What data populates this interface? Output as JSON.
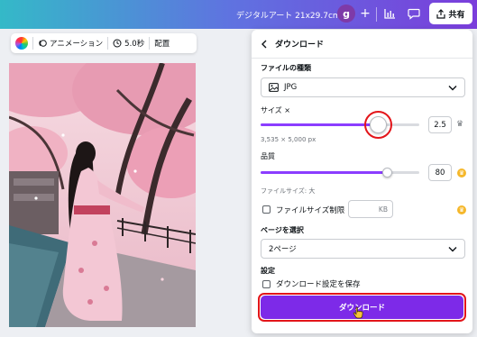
{
  "header": {
    "doc_title": "デジタルアート 21x29.7cm",
    "avatar_letter": "g",
    "plus": "+",
    "share_label": "共有"
  },
  "context_toolbar": {
    "animation_label": "アニメーション",
    "duration_label": "5.0秒",
    "position_label": "配置"
  },
  "download_panel": {
    "title": "ダウンロード",
    "file_type_label": "ファイルの種類",
    "file_type_value": "JPG",
    "size_label": "サイズ ×",
    "size_value": "2.5",
    "size_slider_fraction": 0.74,
    "size_dimensions": "3,535 × 5,000 px",
    "quality_label": "品質",
    "quality_value": "80",
    "quality_slider_fraction": 0.8,
    "file_size_text": "ファイルサイズ: 大",
    "limit_checkbox_label": "ファイルサイズ制限",
    "limit_unit": "KB",
    "page_select_label": "ページを選択",
    "page_select_value": "2ページ",
    "settings_label": "設定",
    "save_settings_label": "ダウンロード設定を保存",
    "download_button_label": "ダウンロード"
  },
  "colors": {
    "accent_purple": "#7d2ae8",
    "slider_purple": "#8b3dff",
    "highlight_red": "#e3151a",
    "premium_gold": "#f5b72a"
  },
  "icons": [
    "chevron-left-icon",
    "image-icon",
    "chevron-down-icon",
    "crown-icon",
    "chart-icon",
    "comment-icon",
    "share-icon",
    "clock-icon",
    "animation-icon",
    "cursor-hand-icon"
  ]
}
